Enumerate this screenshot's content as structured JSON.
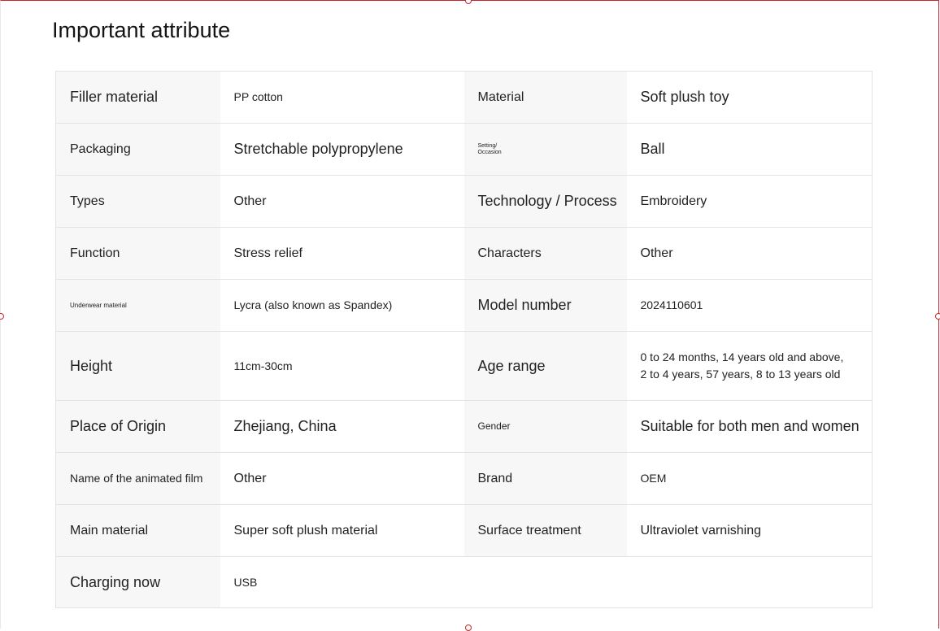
{
  "page": {
    "title": "Important attribute"
  },
  "attributes": [
    [
      {
        "label": "Filler material",
        "value": "PP cotton"
      },
      {
        "label": "Material",
        "value": "Soft plush toy"
      }
    ],
    [
      {
        "label": "Packaging",
        "value": "Stretchable polypropylene"
      },
      {
        "label": "Setting/\nOccasion",
        "value": "Ball"
      }
    ],
    [
      {
        "label": "Types",
        "value": "Other"
      },
      {
        "label": "Technology / Process",
        "value": "Embroidery"
      }
    ],
    [
      {
        "label": "Function",
        "value": "Stress relief"
      },
      {
        "label": "Characters",
        "value": "Other"
      }
    ],
    [
      {
        "label": "Underwear material",
        "value": "Lycra (also known as Spandex)"
      },
      {
        "label": "Model number",
        "value": "2024110601"
      }
    ],
    [
      {
        "label": "Height",
        "value": "11cm-30cm"
      },
      {
        "label": "Age range",
        "value": "0 to 24 months, 14 years old and above,\n 2 to 4 years, 57 years, 8 to 13 years old"
      }
    ],
    [
      {
        "label": "Place of Origin",
        "value": "Zhejiang, China"
      },
      {
        "label": "Gender",
        "value": "Suitable for both men and women"
      }
    ],
    [
      {
        "label": "Name of the animated film",
        "value": "Other"
      },
      {
        "label": "Brand",
        "value": "OEM"
      }
    ],
    [
      {
        "label": "Main material",
        "value": "Super soft plush material"
      },
      {
        "label": "Surface treatment",
        "value": "Ultraviolet varnishing"
      }
    ],
    [
      {
        "label": "Charging now",
        "value": "USB"
      }
    ]
  ]
}
